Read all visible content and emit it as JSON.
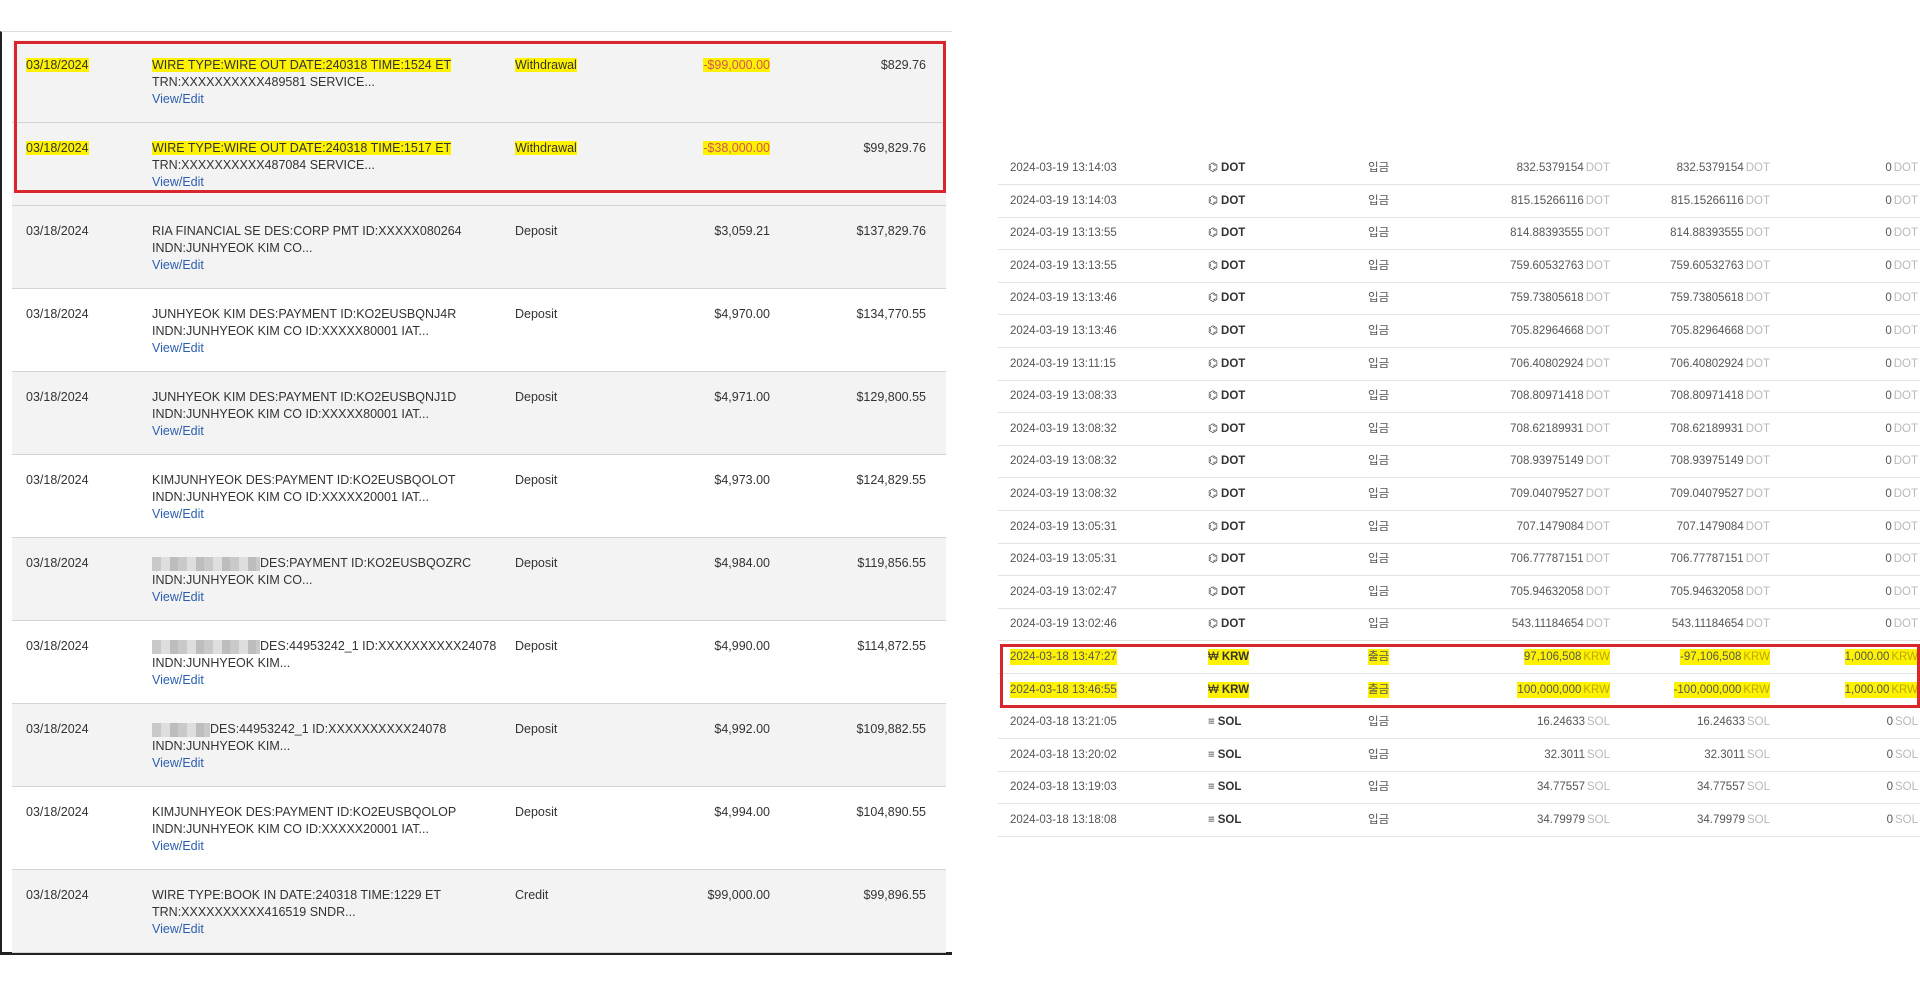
{
  "bank": {
    "rows": [
      {
        "date": "03/18/2024",
        "desc1": "WIRE TYPE:WIRE OUT DATE:240318 TIME:1524 ET",
        "desc2": "TRN:XXXXXXXXXX489581 SERVICE...",
        "link": "View/Edit",
        "type": "Withdrawal",
        "amount": "-$99,000.00",
        "balance": "$829.76"
      },
      {
        "date": "03/18/2024",
        "desc1": "WIRE TYPE:WIRE OUT DATE:240318 TIME:1517 ET",
        "desc2": "TRN:XXXXXXXXXX487084 SERVICE...",
        "link": "View/Edit",
        "type": "Withdrawal",
        "amount": "-$38,000.00",
        "balance": "$99,829.76"
      },
      {
        "date": "03/18/2024",
        "desc1": "RIA FINANCIAL SE DES:CORP PMT ID:XXXXX080264",
        "desc2": "INDN:JUNHYEOK KIM CO...",
        "link": "View/Edit",
        "type": "Deposit",
        "amount": "$3,059.21",
        "balance": "$137,829.76"
      },
      {
        "date": "03/18/2024",
        "desc1": "JUNHYEOK KIM DES:PAYMENT ID:KO2EUSBQNJ4R",
        "desc2": "INDN:JUNHYEOK KIM CO ID:XXXXX80001 IAT...",
        "link": "View/Edit",
        "type": "Deposit",
        "amount": "$4,970.00",
        "balance": "$134,770.55"
      },
      {
        "date": "03/18/2024",
        "desc1": "JUNHYEOK KIM DES:PAYMENT ID:KO2EUSBQNJ1D",
        "desc2": "INDN:JUNHYEOK KIM CO ID:XXXXX80001 IAT...",
        "link": "View/Edit",
        "type": "Deposit",
        "amount": "$4,971.00",
        "balance": "$129,800.55"
      },
      {
        "date": "03/18/2024",
        "desc1": "KIMJUNHYEOK DES:PAYMENT ID:KO2EUSBQOLOT",
        "desc2": "INDN:JUNHYEOK KIM CO ID:XXXXX20001 IAT...",
        "link": "View/Edit",
        "type": "Deposit",
        "amount": "$4,973.00",
        "balance": "$124,829.55"
      },
      {
        "date": "03/18/2024",
        "desc1": "DES:PAYMENT ID:KO2EUSBQOZRC",
        "desc2": "INDN:JUNHYEOK KIM CO...",
        "link": "View/Edit",
        "type": "Deposit",
        "amount": "$4,984.00",
        "balance": "$119,856.55"
      },
      {
        "date": "03/18/2024",
        "desc1": "DES:44953242_1 ID:XXXXXXXXXX24078",
        "desc2": "INDN:JUNHYEOK KIM...",
        "link": "View/Edit",
        "type": "Deposit",
        "amount": "$4,990.00",
        "balance": "$114,872.55"
      },
      {
        "date": "03/18/2024",
        "desc1": "DES:44953242_1 ID:XXXXXXXXXX24078",
        "desc2": "INDN:JUNHYEOK KIM...",
        "link": "View/Edit",
        "type": "Deposit",
        "amount": "$4,992.00",
        "balance": "$109,882.55"
      },
      {
        "date": "03/18/2024",
        "desc1": "KIMJUNHYEOK DES:PAYMENT ID:KO2EUSBQOLOP",
        "desc2": "INDN:JUNHYEOK KIM CO ID:XXXXX20001 IAT...",
        "link": "View/Edit",
        "type": "Deposit",
        "amount": "$4,994.00",
        "balance": "$104,890.55"
      },
      {
        "date": "03/18/2024",
        "desc1": "WIRE TYPE:BOOK IN DATE:240318 TIME:1229 ET",
        "desc2": "TRN:XXXXXXXXXX416519 SNDR...",
        "link": "View/Edit",
        "type": "Credit",
        "amount": "$99,000.00",
        "balance": "$99,896.55"
      }
    ]
  },
  "crypto": {
    "rows": [
      {
        "datetime": "2024-03-19 13:14:03",
        "icon": "polkadot-icon",
        "glyph": "⌬",
        "coin": "DOT",
        "kind": "입금",
        "qty": "832.5379154",
        "qty_unit": "DOT",
        "bal": "832.5379154",
        "bal_unit": "DOT",
        "fee": "0",
        "fee_unit": "DOT"
      },
      {
        "datetime": "2024-03-19 13:14:03",
        "icon": "polkadot-icon",
        "glyph": "⌬",
        "coin": "DOT",
        "kind": "입금",
        "qty": "815.15266116",
        "qty_unit": "DOT",
        "bal": "815.15266116",
        "bal_unit": "DOT",
        "fee": "0",
        "fee_unit": "DOT"
      },
      {
        "datetime": "2024-03-19 13:13:55",
        "icon": "polkadot-icon",
        "glyph": "⌬",
        "coin": "DOT",
        "kind": "입금",
        "qty": "814.88393555",
        "qty_unit": "DOT",
        "bal": "814.88393555",
        "bal_unit": "DOT",
        "fee": "0",
        "fee_unit": "DOT"
      },
      {
        "datetime": "2024-03-19 13:13:55",
        "icon": "polkadot-icon",
        "glyph": "⌬",
        "coin": "DOT",
        "kind": "입금",
        "qty": "759.60532763",
        "qty_unit": "DOT",
        "bal": "759.60532763",
        "bal_unit": "DOT",
        "fee": "0",
        "fee_unit": "DOT"
      },
      {
        "datetime": "2024-03-19 13:13:46",
        "icon": "polkadot-icon",
        "glyph": "⌬",
        "coin": "DOT",
        "kind": "입금",
        "qty": "759.73805618",
        "qty_unit": "DOT",
        "bal": "759.73805618",
        "bal_unit": "DOT",
        "fee": "0",
        "fee_unit": "DOT"
      },
      {
        "datetime": "2024-03-19 13:13:46",
        "icon": "polkadot-icon",
        "glyph": "⌬",
        "coin": "DOT",
        "kind": "입금",
        "qty": "705.82964668",
        "qty_unit": "DOT",
        "bal": "705.82964668",
        "bal_unit": "DOT",
        "fee": "0",
        "fee_unit": "DOT"
      },
      {
        "datetime": "2024-03-19 13:11:15",
        "icon": "polkadot-icon",
        "glyph": "⌬",
        "coin": "DOT",
        "kind": "입금",
        "qty": "706.40802924",
        "qty_unit": "DOT",
        "bal": "706.40802924",
        "bal_unit": "DOT",
        "fee": "0",
        "fee_unit": "DOT"
      },
      {
        "datetime": "2024-03-19 13:08:33",
        "icon": "polkadot-icon",
        "glyph": "⌬",
        "coin": "DOT",
        "kind": "입금",
        "qty": "708.80971418",
        "qty_unit": "DOT",
        "bal": "708.80971418",
        "bal_unit": "DOT",
        "fee": "0",
        "fee_unit": "DOT"
      },
      {
        "datetime": "2024-03-19 13:08:32",
        "icon": "polkadot-icon",
        "glyph": "⌬",
        "coin": "DOT",
        "kind": "입금",
        "qty": "708.62189931",
        "qty_unit": "DOT",
        "bal": "708.62189931",
        "bal_unit": "DOT",
        "fee": "0",
        "fee_unit": "DOT"
      },
      {
        "datetime": "2024-03-19 13:08:32",
        "icon": "polkadot-icon",
        "glyph": "⌬",
        "coin": "DOT",
        "kind": "입금",
        "qty": "708.93975149",
        "qty_unit": "DOT",
        "bal": "708.93975149",
        "bal_unit": "DOT",
        "fee": "0",
        "fee_unit": "DOT"
      },
      {
        "datetime": "2024-03-19 13:08:32",
        "icon": "polkadot-icon",
        "glyph": "⌬",
        "coin": "DOT",
        "kind": "입금",
        "qty": "709.04079527",
        "qty_unit": "DOT",
        "bal": "709.04079527",
        "bal_unit": "DOT",
        "fee": "0",
        "fee_unit": "DOT"
      },
      {
        "datetime": "2024-03-19 13:05:31",
        "icon": "polkadot-icon",
        "glyph": "⌬",
        "coin": "DOT",
        "kind": "입금",
        "qty": "707.1479084",
        "qty_unit": "DOT",
        "bal": "707.1479084",
        "bal_unit": "DOT",
        "fee": "0",
        "fee_unit": "DOT"
      },
      {
        "datetime": "2024-03-19 13:05:31",
        "icon": "polkadot-icon",
        "glyph": "⌬",
        "coin": "DOT",
        "kind": "입금",
        "qty": "706.77787151",
        "qty_unit": "DOT",
        "bal": "706.77787151",
        "bal_unit": "DOT",
        "fee": "0",
        "fee_unit": "DOT"
      },
      {
        "datetime": "2024-03-19 13:02:47",
        "icon": "polkadot-icon",
        "glyph": "⌬",
        "coin": "DOT",
        "kind": "입금",
        "qty": "705.94632058",
        "qty_unit": "DOT",
        "bal": "705.94632058",
        "bal_unit": "DOT",
        "fee": "0",
        "fee_unit": "DOT"
      },
      {
        "datetime": "2024-03-19 13:02:46",
        "icon": "polkadot-icon",
        "glyph": "⌬",
        "coin": "DOT",
        "kind": "입금",
        "qty": "543.11184654",
        "qty_unit": "DOT",
        "bal": "543.11184654",
        "bal_unit": "DOT",
        "fee": "0",
        "fee_unit": "DOT"
      },
      {
        "datetime": "2024-03-18 13:47:27",
        "icon": "won-icon",
        "glyph": "₩",
        "coin": "KRW",
        "kind": "출금",
        "qty": "97,106,508",
        "qty_unit": "KRW",
        "bal": "-97,106,508",
        "bal_unit": "KRW",
        "fee": "1,000.00",
        "fee_unit": "KRW"
      },
      {
        "datetime": "2024-03-18 13:46:55",
        "icon": "won-icon",
        "glyph": "₩",
        "coin": "KRW",
        "kind": "출금",
        "qty": "100,000,000",
        "qty_unit": "KRW",
        "bal": "-100,000,000",
        "bal_unit": "KRW",
        "fee": "1,000.00",
        "fee_unit": "KRW"
      },
      {
        "datetime": "2024-03-18 13:21:05",
        "icon": "solana-icon",
        "glyph": "≡",
        "coin": "SOL",
        "kind": "입금",
        "qty": "16.24633",
        "qty_unit": "SOL",
        "bal": "16.24633",
        "bal_unit": "SOL",
        "fee": "0",
        "fee_unit": "SOL"
      },
      {
        "datetime": "2024-03-18 13:20:02",
        "icon": "solana-icon",
        "glyph": "≡",
        "coin": "SOL",
        "kind": "입금",
        "qty": "32.3011",
        "qty_unit": "SOL",
        "bal": "32.3011",
        "bal_unit": "SOL",
        "fee": "0",
        "fee_unit": "SOL"
      },
      {
        "datetime": "2024-03-18 13:19:03",
        "icon": "solana-icon",
        "glyph": "≡",
        "coin": "SOL",
        "kind": "입금",
        "qty": "34.77557",
        "qty_unit": "SOL",
        "bal": "34.77557",
        "bal_unit": "SOL",
        "fee": "0",
        "fee_unit": "SOL"
      },
      {
        "datetime": "2024-03-18 13:18:08",
        "icon": "solana-icon",
        "glyph": "≡",
        "coin": "SOL",
        "kind": "입금",
        "qty": "34.79979",
        "qty_unit": "SOL",
        "bal": "34.79979",
        "bal_unit": "SOL",
        "fee": "0",
        "fee_unit": "SOL"
      }
    ]
  },
  "colors": {
    "highlight": "#fff200",
    "annotation_box": "#d8262c",
    "link": "#2b5eaf",
    "negative_amount": "#d45555"
  }
}
